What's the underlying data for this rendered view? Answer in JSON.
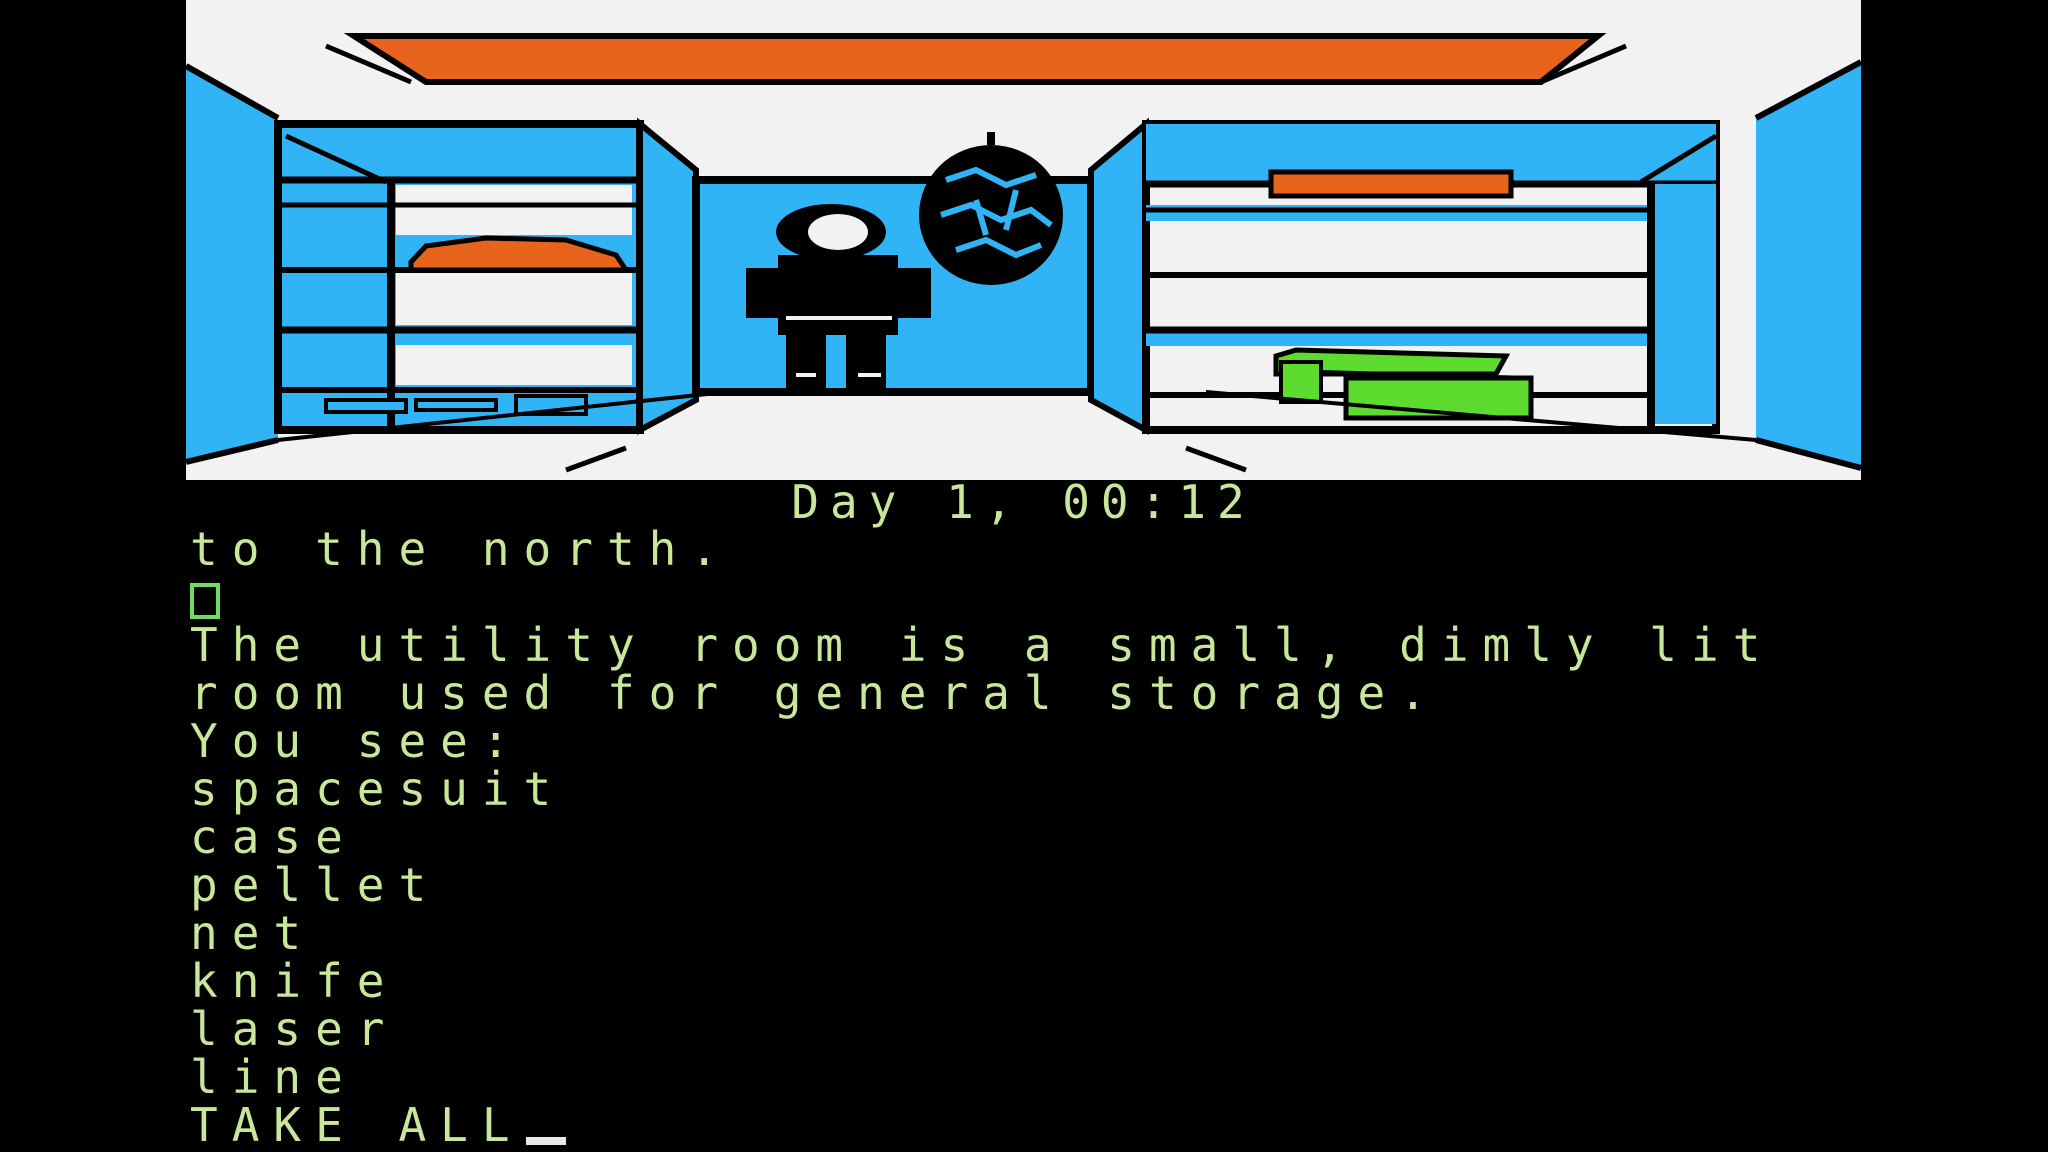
{
  "status": {
    "day_time": "Day 1, 00:12"
  },
  "log": {
    "lines": [
      "to the north.",
      "The utility room is a small, dimly lit",
      "room used for general storage.",
      "You see:",
      "spacesuit",
      "case",
      "pellet",
      "net",
      "knife",
      "laser",
      "line"
    ],
    "input": "TAKE ALL"
  },
  "scene": {
    "colors": {
      "wall": "#31b4f5",
      "floor": "#f2f2f2",
      "ceiling_light": "#e8641c",
      "outline": "#000000",
      "case_green": "#5ddb2f",
      "text": "#c8e79a"
    },
    "objects": [
      "spacesuit",
      "net",
      "case",
      "pellet",
      "knife",
      "laser",
      "line"
    ]
  }
}
